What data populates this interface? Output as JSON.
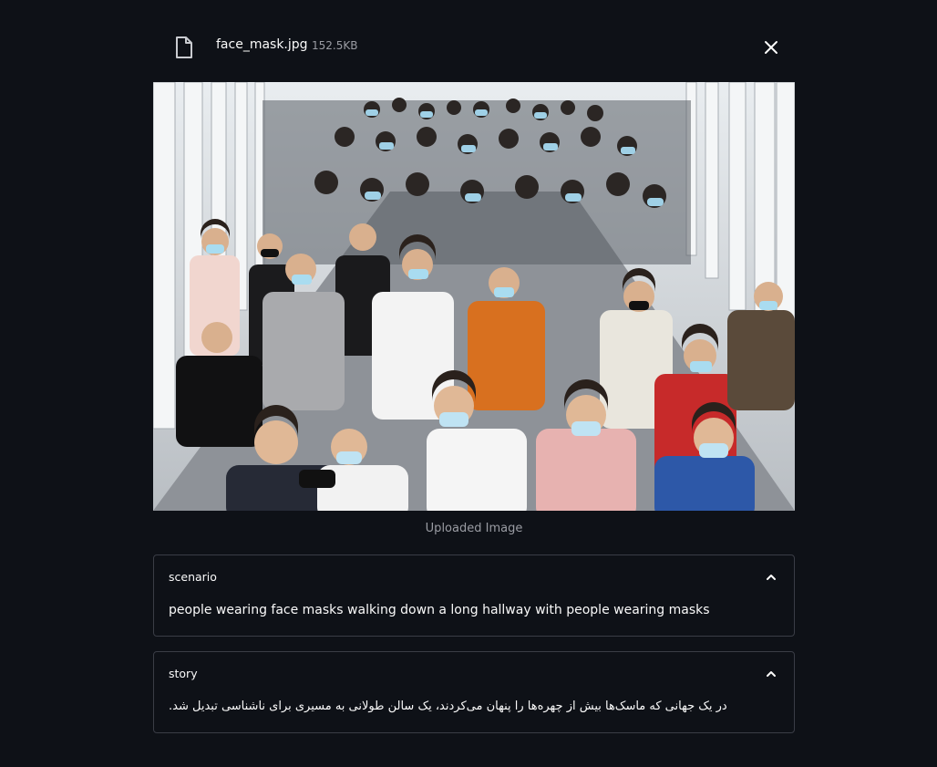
{
  "file": {
    "icon": "file-icon",
    "name": "face_mask.jpg",
    "size": "152.5KB",
    "close_icon": "close-icon"
  },
  "image": {
    "caption": "Uploaded Image",
    "description_icon": "photo-crowd"
  },
  "expanders": {
    "scenario": {
      "label": "scenario",
      "text": "people wearing face masks walking down a long hallway with people wearing masks",
      "icon": "chevron-up-icon"
    },
    "story": {
      "label": "story",
      "text": "در یک جهانی که ماسک‌ها بیش از چهره‌ها را پنهان می‌کردند، یک سالن طولانی به مسیری برای ناشناسی تبدیل شد.",
      "icon": "chevron-up-icon"
    }
  },
  "colors": {
    "background": "#0e1117",
    "border": "#3a3d46",
    "muted_text": "#9a9ca3"
  }
}
